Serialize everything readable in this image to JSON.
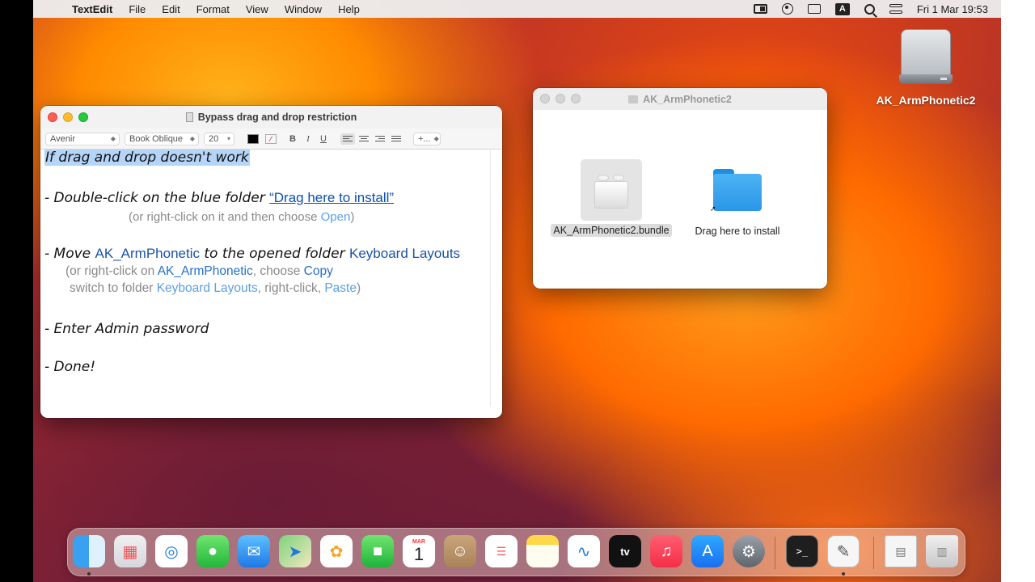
{
  "menubar": {
    "app_name": "TextEdit",
    "menus": [
      "File",
      "Edit",
      "Format",
      "View",
      "Window",
      "Help"
    ],
    "input_source": "A",
    "clock": "Fri 1 Mar  19:53"
  },
  "textedit": {
    "title": "Bypass drag and drop restriction",
    "toolbar": {
      "font_family": "Avenir",
      "font_style": "Book Oblique",
      "font_size": "20",
      "bold": "B",
      "italic": "I",
      "underline": "U",
      "more": "+..."
    },
    "lines": {
      "l1": "If drag and drop doesn't work",
      "l2_a": "- Double-click on the blue folder ",
      "l2_link": "“Drag here to install”",
      "l3_a": "(or right-click on it and then choose ",
      "l3_open": "Open",
      "l3_b": ")",
      "l4_a": "- Move ",
      "l4_name": "AK_ArmPhonetic",
      "l4_b": " to the opened folder ",
      "l4_folder": "Keyboard Layouts",
      "l5_a": "(or right-click on ",
      "l5_name": "AK_ArmPhonetic",
      "l5_b": ", choose ",
      "l5_copy": "Copy",
      "l6_a": "switch to folder ",
      "l6_folder": "Keyboard Layouts",
      "l6_b": ", right-click, ",
      "l6_paste": "Paste",
      "l6_c": ")",
      "l7": "- Enter Admin password",
      "l8": "- Done!"
    }
  },
  "finder": {
    "title": "AK_ArmPhonetic2",
    "items": [
      {
        "label": "AK_ArmPhonetic2.bundle",
        "icon": "bundle-icon"
      },
      {
        "label": "Drag here to install",
        "icon": "folder-alias-icon"
      }
    ]
  },
  "desktop": {
    "drive_label": "AK_ArmPhonetic2"
  },
  "dock": {
    "apps": [
      "Finder",
      "Launchpad",
      "Safari",
      "Messages",
      "Mail",
      "Maps",
      "Photos",
      "FaceTime",
      "Calendar",
      "Contacts",
      "Reminders",
      "Notes",
      "Freeform",
      "TV",
      "Music",
      "App Store",
      "System Settings",
      "Terminal",
      "TextEdit",
      "Document",
      "Trash"
    ],
    "calendar_month": "MAR",
    "calendar_day": "1",
    "tv_label": "tv",
    "terminal_prompt": ">_"
  },
  "colors": {
    "link_blue": "#0b4fb0",
    "selection": "#b5d5f8",
    "folder_blue": "#2a96e6"
  }
}
